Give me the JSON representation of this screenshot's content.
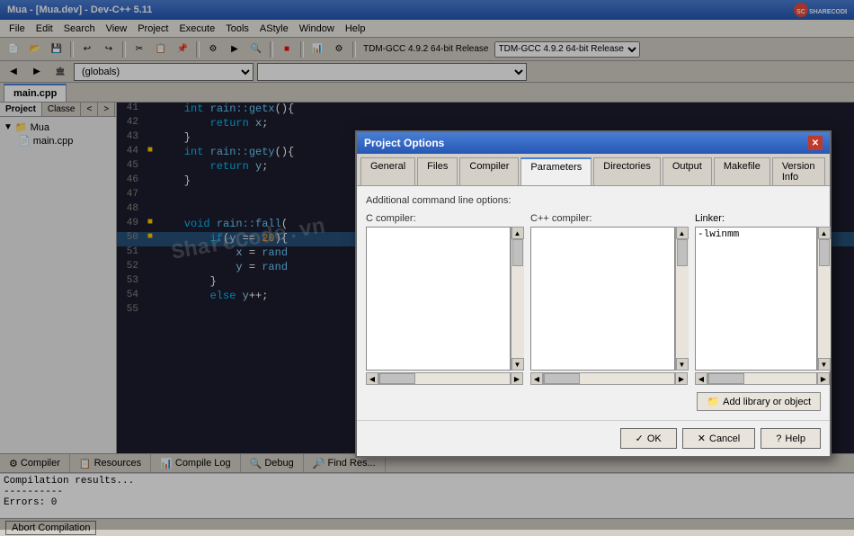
{
  "titleBar": {
    "title": "Mua - [Mua.dev] - Dev-C++ 5.11"
  },
  "menuBar": {
    "items": [
      "File",
      "Edit",
      "Search",
      "View",
      "Project",
      "Execute",
      "Tools",
      "AStyle",
      "Window",
      "Help"
    ]
  },
  "globals": {
    "value": "(globals)"
  },
  "projectPanel": {
    "tabs": [
      "Project",
      "Classe",
      "<",
      ">"
    ],
    "treeItems": [
      {
        "label": "Mua",
        "type": "project",
        "indent": 0
      },
      {
        "label": "main.cpp",
        "type": "file",
        "indent": 1
      }
    ]
  },
  "editorTabs": [
    {
      "label": "main.cpp",
      "active": true
    }
  ],
  "codeLines": [
    {
      "num": "41",
      "marker": false,
      "text": "    int rain::getx(){"
    },
    {
      "num": "42",
      "marker": false,
      "text": "        return x;"
    },
    {
      "num": "43",
      "marker": false,
      "text": "    }"
    },
    {
      "num": "44",
      "marker": false,
      "text": "    int rain::gety(){"
    },
    {
      "num": "45",
      "marker": false,
      "text": "        return y;"
    },
    {
      "num": "46",
      "marker": false,
      "text": "    }"
    },
    {
      "num": "47",
      "marker": false,
      "text": ""
    },
    {
      "num": "48",
      "marker": false,
      "text": ""
    },
    {
      "num": "49",
      "marker": true,
      "text": "    void rain::fall("
    },
    {
      "num": "50",
      "marker": true,
      "text": "        if(y == 20){"
    },
    {
      "num": "51",
      "marker": false,
      "text": "            x = rand"
    },
    {
      "num": "52",
      "marker": false,
      "text": "            y = rand"
    },
    {
      "num": "53",
      "marker": false,
      "text": "        }"
    },
    {
      "num": "54",
      "marker": false,
      "text": "        else y++;"
    },
    {
      "num": "55",
      "marker": false,
      "text": ""
    }
  ],
  "watermark": "ShareCode.vn",
  "bottomTabs": [
    {
      "label": "Compiler",
      "icon": "⚙"
    },
    {
      "label": "Resources",
      "icon": "📋"
    },
    {
      "label": "Compile Log",
      "icon": "📊"
    },
    {
      "label": "Debug",
      "icon": "🔍"
    },
    {
      "label": "Find Res...",
      "icon": "🔎"
    }
  ],
  "bottomPanel": {
    "lines": [
      "Compilation results...",
      "----------",
      "Errors: 0"
    ]
  },
  "statusBar": {
    "abortLabel": "Abort Compilation"
  },
  "dialog": {
    "title": "Project Options",
    "closeBtn": "✕",
    "tabs": [
      "General",
      "Files",
      "Compiler",
      "Parameters",
      "Directories",
      "Output",
      "Makefile",
      "Version Info"
    ],
    "activeTab": "Parameters",
    "subtitle": "Additional command line options:",
    "cCompilerLabel": "C compiler:",
    "cppCompilerLabel": "C++ compiler:",
    "linkerLabel": "Linker:",
    "linkerValue": "-lwinmm",
    "addLibLabel": "Add library or object",
    "buttons": {
      "ok": "OK",
      "cancel": "Cancel",
      "help": "Help"
    }
  },
  "sharecode": {
    "logo": "SHARECODE.VN"
  }
}
